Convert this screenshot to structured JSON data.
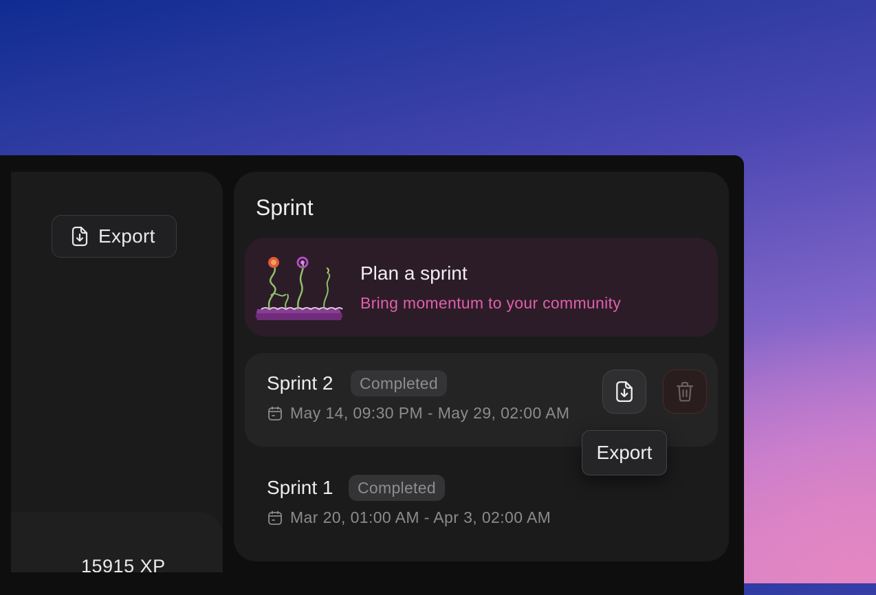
{
  "left_panel": {
    "export_label": "Export",
    "xp_text": "15915 XP"
  },
  "sprint_panel": {
    "title": "Sprint",
    "plan_card": {
      "title": "Plan a sprint",
      "subtitle": "Bring momentum to your community",
      "subtitle_color": "#e060a8"
    },
    "sprints": [
      {
        "name": "Sprint 2",
        "status": "Completed",
        "dates": "May 14, 09:30 PM - May 29, 02:00 AM"
      },
      {
        "name": "Sprint 1",
        "status": "Completed",
        "dates": "Mar 20, 01:00 AM - Apr 3, 02:00 AM"
      }
    ]
  },
  "tooltip": {
    "text": "Export"
  },
  "icons": {
    "export": "file-download-icon",
    "delete": "trash-icon",
    "calendar": "calendar-icon"
  }
}
